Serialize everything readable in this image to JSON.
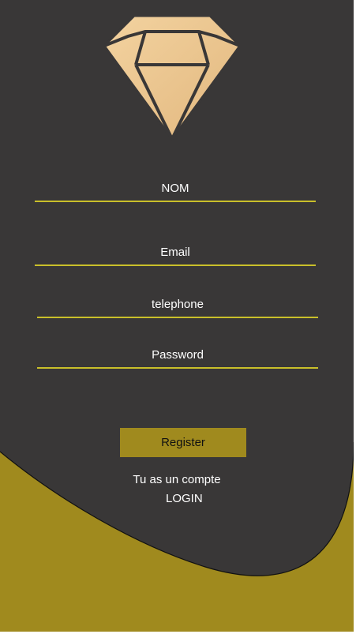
{
  "colors": {
    "background": "#393737",
    "accent": "#a08a1e",
    "underline": "#c9bf2a",
    "gem_fill": "#edc791"
  },
  "logo": {
    "icon": "diamond-icon"
  },
  "form": {
    "nom_placeholder": "NOM",
    "email_placeholder": "Email",
    "telephone_placeholder": "telephone",
    "password_placeholder": "Password"
  },
  "actions": {
    "register_label": "Register",
    "have_account_text": "Tu as un compte",
    "login_label": "LOGIN"
  }
}
